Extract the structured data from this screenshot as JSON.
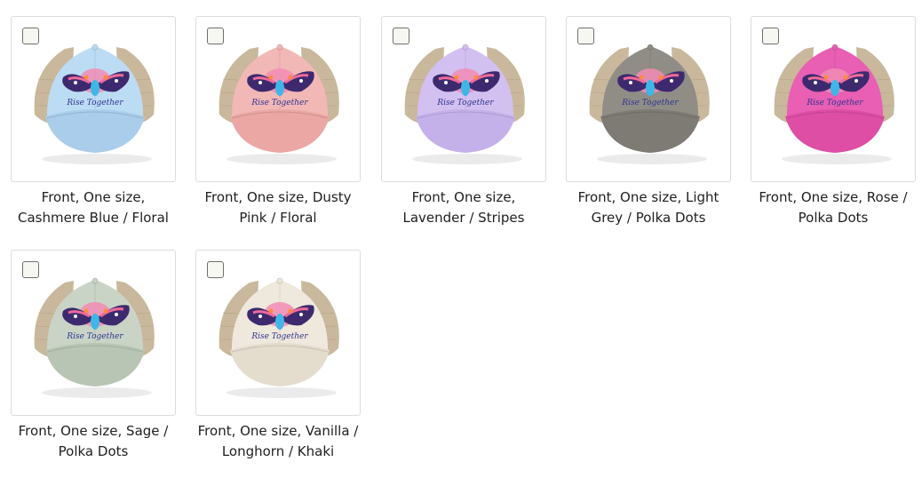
{
  "variants": [
    {
      "label": "Front, One size, Cashmere Blue / Floral",
      "crown": "#bcdcf4",
      "brim": "#a9cdea",
      "mesh": "#c9b89c"
    },
    {
      "label": "Front, One size, Dusty Pink / Floral",
      "crown": "#f2b8b6",
      "brim": "#eba7a4",
      "mesh": "#c9b89c"
    },
    {
      "label": "Front, One size, Lavender / Stripes",
      "crown": "#d2c0f1",
      "brim": "#c4b1ea",
      "mesh": "#c9b89c"
    },
    {
      "label": "Front, One size, Light Grey / Polka Dots",
      "crown": "#8f8d86",
      "brim": "#7d7b74",
      "mesh": "#c9b89c"
    },
    {
      "label": "Front, One size, Rose / Polka Dots",
      "crown": "#e85fb3",
      "brim": "#dd4ea4",
      "mesh": "#c9b89c"
    },
    {
      "label": "Front, One size, Sage / Polka Dots",
      "crown": "#c9d4c6",
      "brim": "#b8c5b4",
      "mesh": "#c9b89c"
    },
    {
      "label": "Front, One size, Vanilla / Longhorn / Khaki",
      "crown": "#efe8dc",
      "brim": "#e4dccd",
      "mesh": "#c9b89c"
    }
  ],
  "print_text": "Rise Together",
  "print_color": "#2f3590"
}
